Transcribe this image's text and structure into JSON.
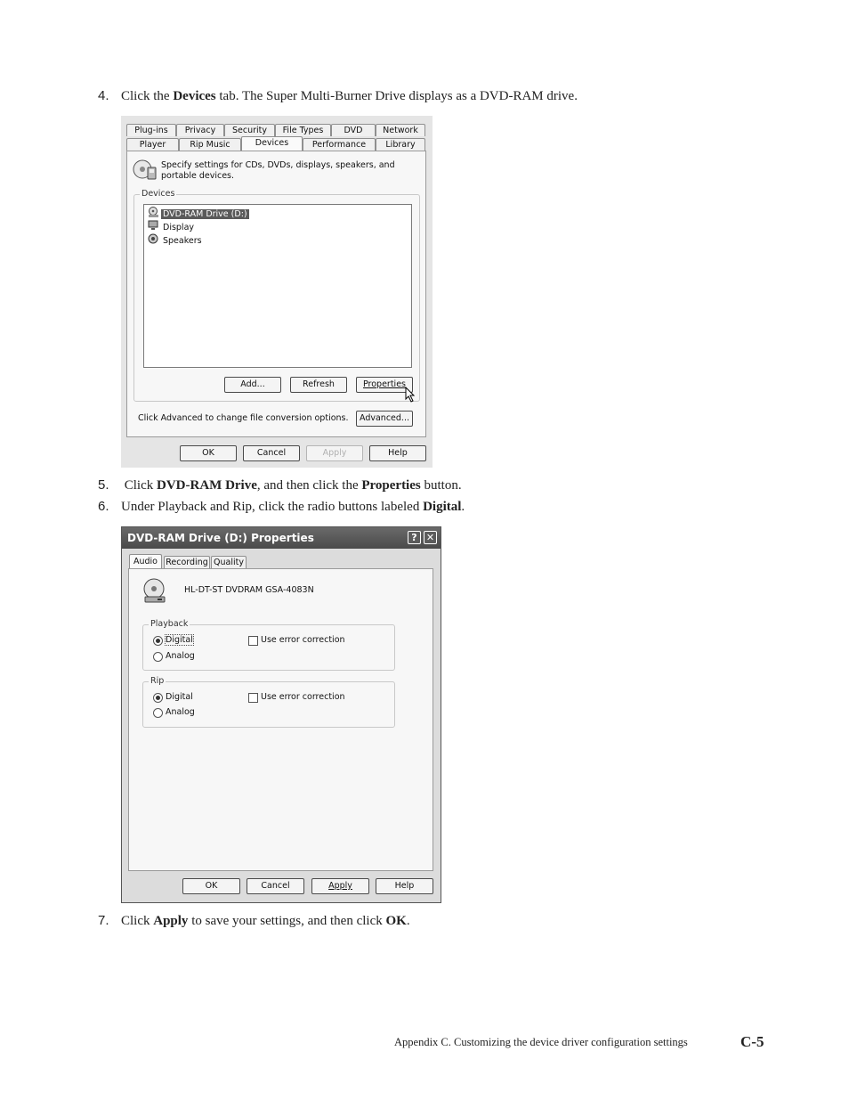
{
  "steps": [
    {
      "num": "4.",
      "t1": "Click the ",
      "b1": "Devices",
      "t2": " tab. The Super Multi-Burner Drive displays as a DVD-RAM drive."
    },
    {
      "num": "5.",
      "t1": "Click ",
      "b1": "DVD-RAM Drive",
      "t2": ", and then click the ",
      "b2": "Properties",
      "t3": " button."
    },
    {
      "num": "6.",
      "t1": "Under Playback and Rip, click the radio buttons labeled ",
      "b1": "Digital",
      "t2": "."
    },
    {
      "num": "7.",
      "t1": "Click ",
      "b1": "Apply",
      "t2": " to save your settings, and then click ",
      "b2": "OK",
      "t3": "."
    }
  ],
  "options_dialog": {
    "tabs_row1": [
      "Plug-ins",
      "Privacy",
      "Security",
      "File Types",
      "DVD",
      "Network"
    ],
    "tabs_row2": [
      "Player",
      "Rip Music",
      "Devices",
      "Performance",
      "Library"
    ],
    "active_tab": "Devices",
    "description": "Specify settings for CDs, DVDs, displays, speakers, and portable devices.",
    "devices_group_label": "Devices",
    "devices": [
      "DVD-RAM Drive (D:)",
      "Display",
      "Speakers"
    ],
    "selected_device": "DVD-RAM Drive (D:)",
    "add_button": "Add...",
    "refresh_button": "Refresh",
    "properties_button": "Properties",
    "advanced_text": "Click Advanced to change file conversion options.",
    "advanced_button": "Advanced...",
    "ok": "OK",
    "cancel": "Cancel",
    "apply": "Apply",
    "help": "Help"
  },
  "properties_dialog": {
    "title": "DVD-RAM Drive (D:) Properties",
    "title_help": "?",
    "title_close": "✕",
    "tabs": [
      "Audio",
      "Recording",
      "Quality"
    ],
    "active_tab": "Audio",
    "drive_model": "HL-DT-ST DVDRAM GSA-4083N",
    "playback_label": "Playback",
    "rip_label": "Rip",
    "digital": "Digital",
    "analog": "Analog",
    "error_correction": "Use error correction",
    "playback_selected": "Digital",
    "rip_selected": "Digital",
    "ok": "OK",
    "cancel": "Cancel",
    "apply": "Apply",
    "help": "Help"
  },
  "footer": {
    "text": "Appendix C. Customizing the device driver configuration settings",
    "page": "C-5"
  },
  "colors": {
    "title_bar": "#4a4a4a",
    "selection": "#5a5a5a"
  }
}
